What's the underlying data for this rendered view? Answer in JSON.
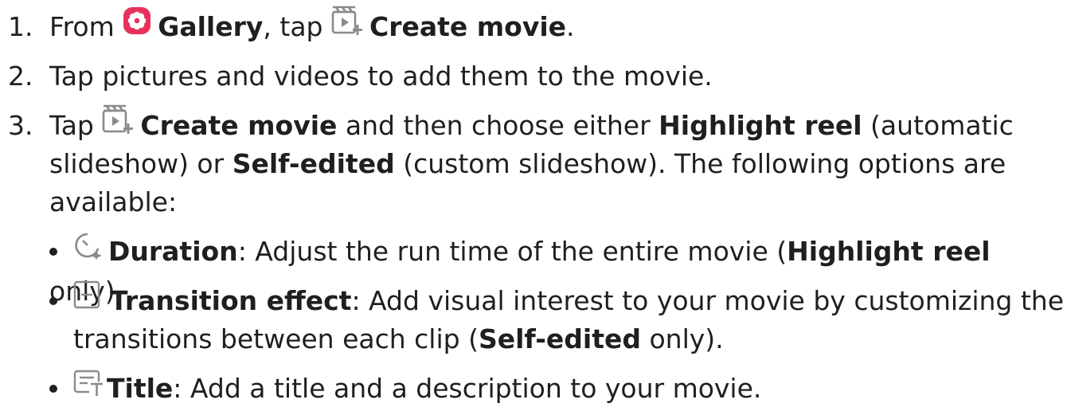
{
  "steps": [
    {
      "num": "1.",
      "p1": "From ",
      "gallery": "Gallery",
      "p2": ", tap ",
      "create_movie": "Create movie",
      "p3": "."
    },
    {
      "num": "2.",
      "text": "Tap pictures and videos to add them to the movie."
    },
    {
      "num": "3.",
      "p1": "Tap ",
      "create_movie": "Create movie",
      "p2": " and then choose either ",
      "highlight": "Highlight reel",
      "p3": " (automatic",
      "line2a": "slideshow) or ",
      "self_edited": "Self-edited",
      "line2b": " (custom slideshow). The following options are",
      "line3": "available:"
    }
  ],
  "options": [
    {
      "icon": "duration-icon",
      "label": "Duration",
      "p1": ": Adjust the run time of the entire movie (",
      "bold": "Highlight reel",
      "p2": " only)."
    },
    {
      "icon": "transition-effect-icon",
      "label": "Transition effect",
      "p1": ": Add visual interest to your movie by customizing the",
      "line2a": "transitions between each clip (",
      "bold": "Self-edited",
      "line2b": " only)."
    },
    {
      "icon": "title-icon",
      "label": "Title",
      "p1": ": Add a title and a description to your movie."
    }
  ],
  "colors": {
    "gallery_icon": "#e8315b",
    "icon_gray": "#8a8a8a",
    "text": "#1f1f1f"
  }
}
